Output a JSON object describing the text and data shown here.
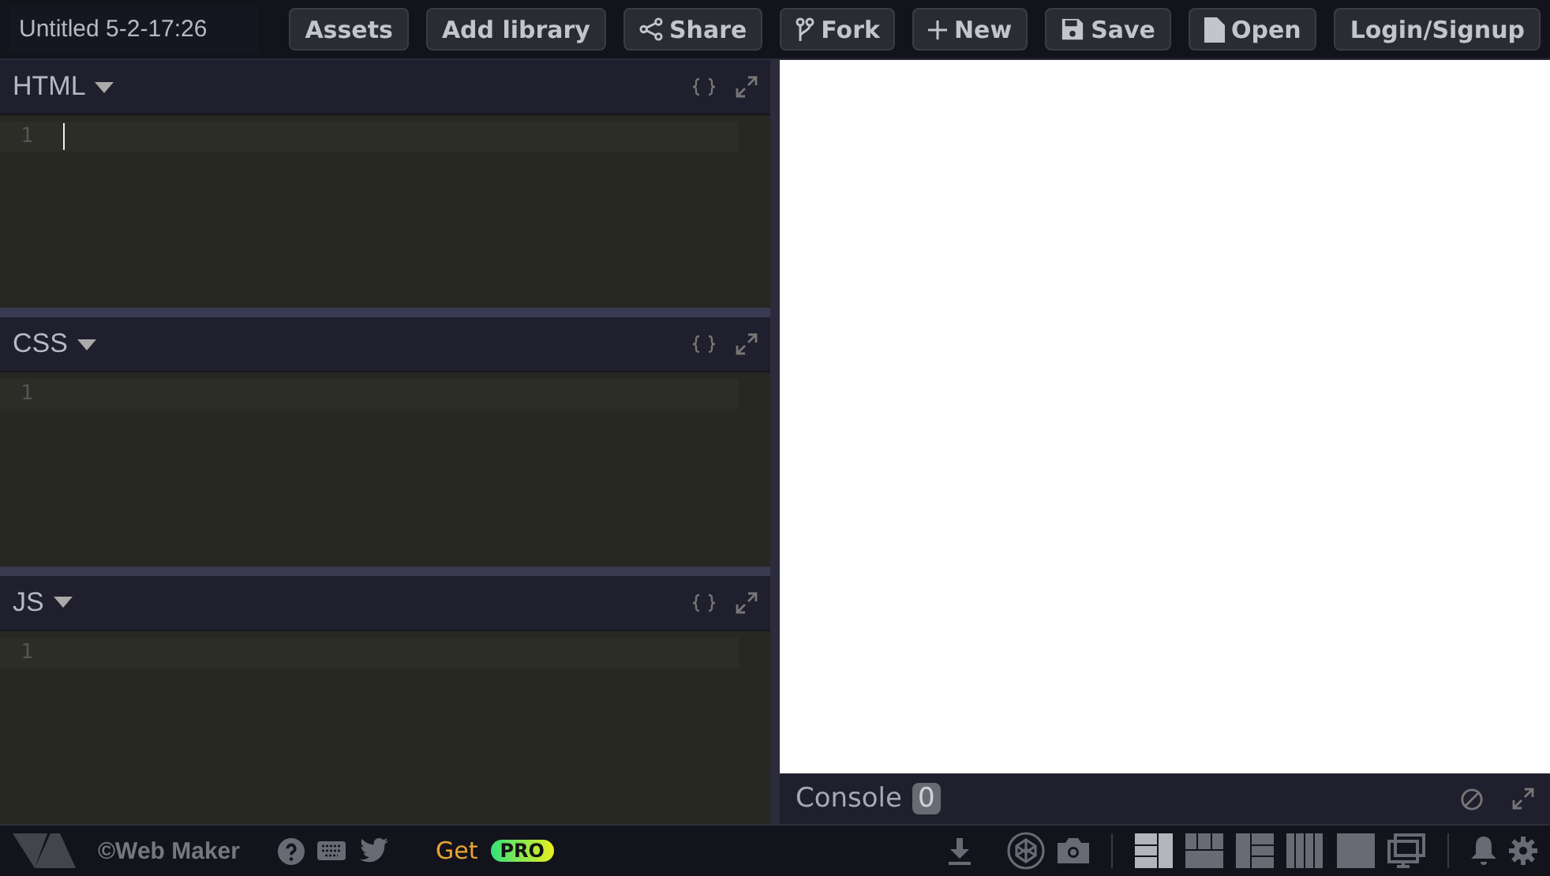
{
  "title": "Untitled 5-2-17:26",
  "toolbar": [
    {
      "label": "Assets",
      "kind": "text"
    },
    {
      "label": "Add library",
      "kind": "text"
    },
    {
      "label": "Share",
      "kind": "share"
    },
    {
      "label": "Fork",
      "kind": "fork"
    },
    {
      "label": "New",
      "kind": "plus"
    },
    {
      "label": "Save",
      "kind": "save"
    },
    {
      "label": "Open",
      "kind": "open"
    },
    {
      "label": "Login/Signup",
      "kind": "text"
    }
  ],
  "editors": [
    {
      "label": "HTML",
      "line": "1",
      "focused": true
    },
    {
      "label": "CSS",
      "line": "1",
      "focused": false
    },
    {
      "label": "JS",
      "line": "1",
      "focused": false
    }
  ],
  "console": {
    "label": "Console",
    "count": "0"
  },
  "footer": {
    "brand": "©Web Maker",
    "get": "Get",
    "pro": "PRO",
    "layouts": [
      {
        "kind": "left",
        "selected": true
      },
      {
        "kind": "top",
        "selected": false
      },
      {
        "kind": "right",
        "selected": false
      },
      {
        "kind": "columns",
        "selected": false
      },
      {
        "kind": "full",
        "selected": false
      }
    ]
  }
}
